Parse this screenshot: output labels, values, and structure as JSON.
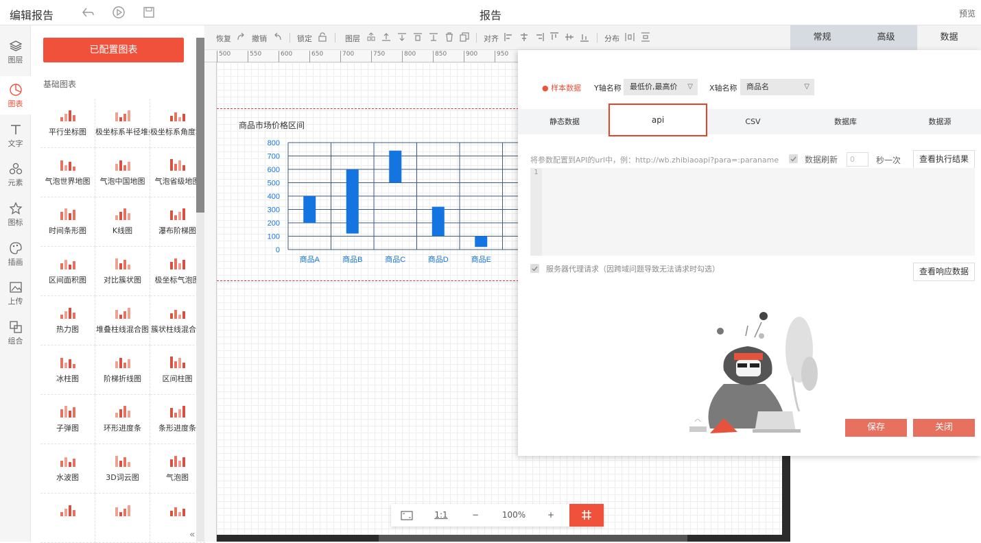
{
  "header": {
    "app_title": "编辑报告",
    "report_title": "报告",
    "preview": "预览"
  },
  "leftnav": {
    "items": [
      {
        "label": "图层",
        "icon": "layers-icon"
      },
      {
        "label": "图表",
        "icon": "chart-pie-icon"
      },
      {
        "label": "文字",
        "icon": "text-icon"
      },
      {
        "label": "元素",
        "icon": "elements-icon"
      },
      {
        "label": "图标",
        "icon": "star-icon"
      },
      {
        "label": "插画",
        "icon": "palette-icon"
      },
      {
        "label": "上传",
        "icon": "upload-image-icon"
      },
      {
        "label": "组合",
        "icon": "group-icon"
      }
    ]
  },
  "panel": {
    "configured_button": "已配置图表",
    "section_label": "基础图表",
    "charts": [
      "平行坐标图",
      "极坐标系半径堆叠图",
      "极坐标系角度堆叠图",
      "气泡世界地图",
      "气泡中国地图",
      "气泡省级地图",
      "时间条形图",
      "K线图",
      "瀑布阶梯图",
      "区间面积图",
      "对比簇状图",
      "极坐标气泡图",
      "热力图",
      "堆叠柱线混合图",
      "簇状柱线混合图",
      "冰柱图",
      "阶梯折线图",
      "区间柱图",
      "子弹图",
      "环形进度条",
      "条形进度条",
      "水波图",
      "3D词云图",
      "气泡图",
      "",
      "",
      ""
    ]
  },
  "toolbar": {
    "restore": "恢复",
    "undo": "撤销",
    "lock": "锁定",
    "layer": "图层",
    "align": "对齐",
    "distribute": "分布"
  },
  "right_tabs": {
    "normal": "常规",
    "advanced": "高级",
    "data": "数据"
  },
  "ruler": {
    "ticks": [
      "500",
      "550",
      "600",
      "650",
      "700",
      "750",
      "800",
      "850",
      "900",
      "950"
    ]
  },
  "chart_data": {
    "type": "bar",
    "title": "商品市场价格区间",
    "categories": [
      "商品A",
      "商品B",
      "商品C",
      "商品D",
      "商品E"
    ],
    "series": [
      {
        "name": "最低价",
        "values": [
          200,
          120,
          500,
          100,
          20
        ]
      },
      {
        "name": "最高价",
        "values": [
          400,
          600,
          740,
          320,
          100
        ]
      }
    ],
    "yticks": [
      "0",
      "100",
      "200",
      "300",
      "400",
      "500",
      "600",
      "700",
      "800"
    ],
    "ylim": [
      0,
      800
    ],
    "grid": true,
    "colors": {
      "bar": "#1474e0",
      "grid": "#3d5a80",
      "axis_text": "#1474e0"
    }
  },
  "zoombar": {
    "one_to_one": "1:1",
    "minus": "−",
    "zoom": "100%",
    "plus": "+"
  },
  "dialog": {
    "sample_data": "样本数据",
    "y_axis_label": "Y轴名称",
    "y_axis_value": "最低价,最高价",
    "x_axis_label": "X轴名称",
    "x_axis_value": "商品名",
    "tabs": {
      "static": "静态数据",
      "api": "api",
      "csv": "CSV",
      "database": "数据库",
      "datasource": "数据源"
    },
    "api_hint": "将参数配置到API的url中，例：http://wb.zhibiaoapi?para=:paraname",
    "refresh_label": "数据刷新",
    "refresh_value": "0",
    "refresh_unit": "秒一次",
    "view_result": "查看执行结果",
    "line_number": "1",
    "proxy_label": "服务器代理请求（因跨域问题导致无法请求时勾选）",
    "view_response": "查看响应数据",
    "save": "保存",
    "close": "关闭"
  },
  "colors": {
    "accent": "#f0513b",
    "button": "#e8705e"
  }
}
